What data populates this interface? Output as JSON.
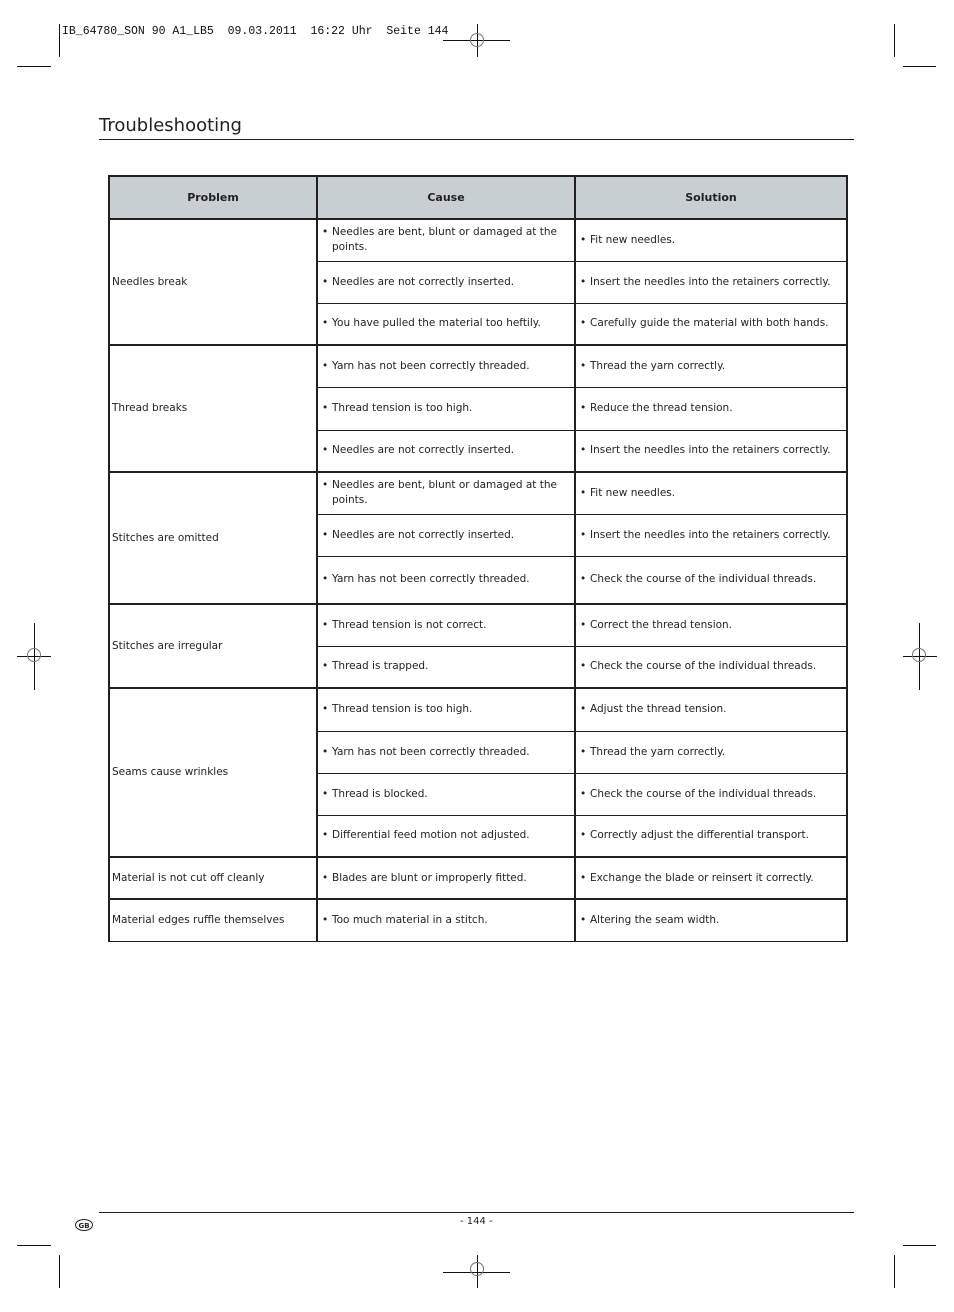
{
  "print_slug": "IB_64780_SON 90 A1_LB5  09.03.2011  16:22 Uhr  Seite 144",
  "section_title": "Troubleshooting",
  "table": {
    "headers": [
      "Problem",
      "Cause",
      "Solution"
    ],
    "groups": [
      {
        "problem": "Needles break",
        "rows": [
          {
            "cause": "Needles are bent, blunt or damaged at the points.",
            "solution": "Fit new needles."
          },
          {
            "cause": "Needles are not correctly inserted.",
            "solution": "Insert the needles into the retainers correctly."
          },
          {
            "cause": "You have pulled the material too heftily.",
            "solution": "Carefully guide the material with both hands."
          }
        ]
      },
      {
        "problem": "Thread breaks",
        "rows": [
          {
            "cause": "Yarn has not been correctly threaded.",
            "solution": "Thread the yarn correctly."
          },
          {
            "cause": "Thread tension is too high.",
            "solution": "Reduce the thread tension."
          },
          {
            "cause": "Needles are not correctly inserted.",
            "solution": "Insert the needles into the retainers correctly."
          }
        ]
      },
      {
        "problem": "Stitches are omitted",
        "rows": [
          {
            "cause": "Needles are bent, blunt or damaged at the points.",
            "solution": "Fit new needles."
          },
          {
            "cause": "Needles are not correctly inserted.",
            "solution": "Insert the needles into the retainers correctly."
          },
          {
            "cause": "Yarn has not been correctly threaded.",
            "solution": "Check the course of the individual threads."
          }
        ]
      },
      {
        "problem": "Stitches are irregular",
        "rows": [
          {
            "cause": "Thread tension is not correct.",
            "solution": "Correct the thread tension."
          },
          {
            "cause": "Thread is trapped.",
            "solution": "Check the course of the individual threads."
          }
        ]
      },
      {
        "problem": "Seams cause wrinkles",
        "rows": [
          {
            "cause": "Thread tension is too high.",
            "solution": "Adjust the thread tension."
          },
          {
            "cause": "Yarn has not been correctly threaded.",
            "solution": "Thread the yarn correctly."
          },
          {
            "cause": "Thread is blocked.",
            "solution": "Check the course of the individual threads."
          },
          {
            "cause": " Differential feed motion not adjusted.",
            "solution": "Correctly adjust the differential transport."
          }
        ]
      },
      {
        "problem": "Material is not cut off cleanly",
        "rows": [
          {
            "cause": "Blades are blunt or improperly fitted.",
            "solution": "Exchange the blade or reinsert it correctly."
          }
        ]
      },
      {
        "problem": "Material edges ruffle themselves",
        "rows": [
          {
            "cause": "Too much material in a stitch.",
            "solution": "Altering the seam width."
          }
        ]
      }
    ]
  },
  "footer": {
    "page_number": "- 144 -",
    "language_badge": "GB"
  },
  "bullet": "•"
}
